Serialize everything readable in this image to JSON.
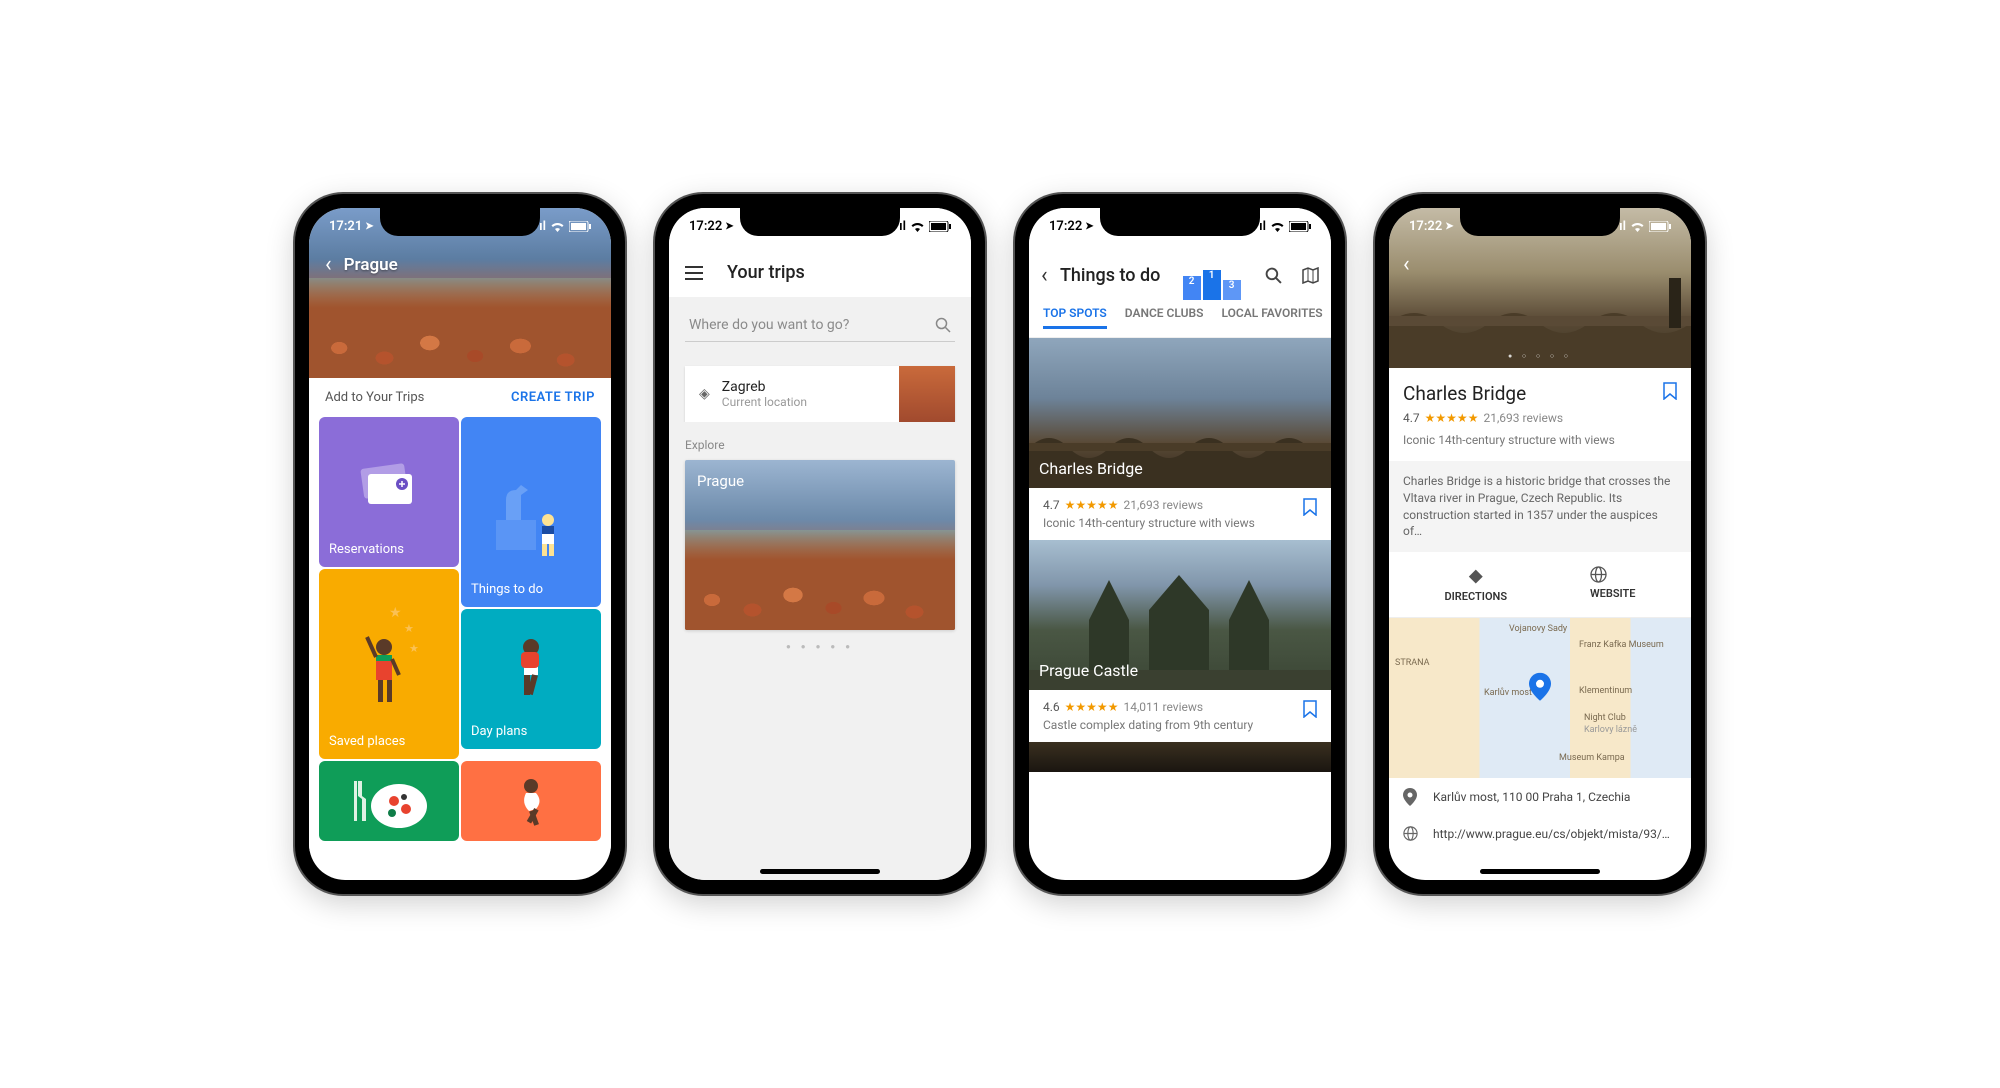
{
  "status": {
    "time1": "17:21",
    "time2": "17:22"
  },
  "screen1": {
    "title": "Prague",
    "add_label": "Add to Your Trips",
    "create_label": "CREATE TRIP",
    "tiles": {
      "reservations": "Reservations",
      "things": "Things to do",
      "saved": "Saved places",
      "day": "Day plans"
    }
  },
  "screen2": {
    "title": "Your trips",
    "search_placeholder": "Where do you want to go?",
    "location": {
      "name": "Zagreb",
      "sub": "Current location"
    },
    "explore_label": "Explore",
    "card_title": "Prague"
  },
  "screen3": {
    "title": "Things to do",
    "tabs": [
      "TOP SPOTS",
      "DANCE CLUBS",
      "LOCAL FAVORITES"
    ],
    "spot1": {
      "name": "Charles Bridge",
      "rating": "4.7",
      "stars": "★★★★★",
      "reviews": "21,693 reviews",
      "desc": "Iconic 14th-century structure with views"
    },
    "spot2": {
      "name": "Prague Castle",
      "rating": "4.6",
      "stars": "★★★★★",
      "reviews": "14,011 reviews",
      "desc": "Castle complex dating from 9th century"
    }
  },
  "screen4": {
    "title": "Charles Bridge",
    "rating": "4.7",
    "stars": "★★★★★",
    "reviews": "21,693 reviews",
    "short_desc": "Iconic 14th-century structure with views",
    "long_desc": "Charles Bridge is a historic bridge that crosses the Vltava river in Prague, Czech Republic. Its construction started in 1357 under the auspices of…",
    "actions": {
      "directions": "DIRECTIONS",
      "website": "WEBSITE"
    },
    "map_labels": {
      "strana": "STRANA",
      "karluv": "Karlův most",
      "klement": "Klementinum",
      "fkm": "Franz Kafka Museum",
      "night": "Night Club",
      "karlovy": "Karlovy lázně",
      "kampa": "Museum Kampa",
      "vojanovy": "Vojanovy Sady"
    },
    "address": "Karlův most, 110 00 Praha 1, Czechia",
    "url": "http://www.prague.eu/cs/objekt/mista/93/…"
  }
}
